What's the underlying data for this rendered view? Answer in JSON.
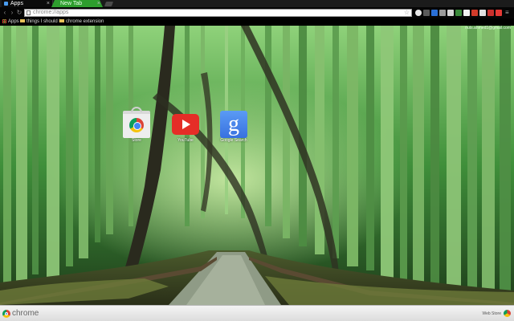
{
  "tabs": [
    {
      "title": "Apps",
      "active": true
    },
    {
      "title": "New Tab",
      "active": false
    }
  ],
  "omnibox": {
    "url": "chrome://apps"
  },
  "bookmarks": {
    "apps_label": "Apps",
    "items": [
      {
        "label": "things I should l..."
      },
      {
        "label": "chrome extension"
      }
    ]
  },
  "user": {
    "email": "nuts.ahmed1@gmail.com"
  },
  "apps": [
    {
      "label": "Store",
      "icon": "webstore-icon"
    },
    {
      "label": "YouTube",
      "icon": "youtube-icon"
    },
    {
      "label": "Google Search",
      "icon": "google-search-icon"
    }
  ],
  "bottom": {
    "brand": "chrome",
    "webstore": "Web Store"
  },
  "colors": {
    "tab_accent": "#2e9e2e",
    "toolbar": "#050505",
    "bottom_bar": "#e6e6e6"
  }
}
